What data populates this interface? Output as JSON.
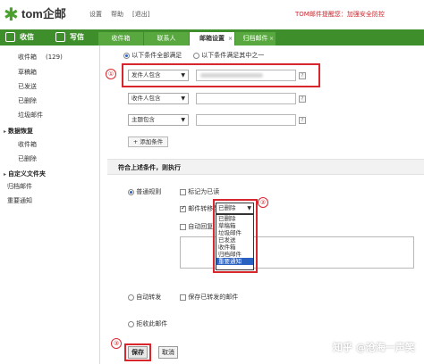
{
  "header": {
    "logo_symbol": "✱",
    "logo_text": "tom企邮",
    "links": [
      "设置",
      "帮助",
      "[退出]"
    ],
    "notice": "TOM邮件提醒您：加强安全防控"
  },
  "nav": {
    "inbox_label": "收信",
    "compose_label": "写信",
    "tabs": [
      {
        "label": "收件箱",
        "active": false
      },
      {
        "label": "联系人",
        "active": false
      },
      {
        "label": "邮箱设置",
        "active": true
      },
      {
        "label": "归档邮件",
        "active": false
      }
    ],
    "close_glyph": "×"
  },
  "sidebar": {
    "folders": [
      {
        "label": "收件箱",
        "count": "(129)"
      },
      {
        "label": "草稿箱",
        "count": ""
      },
      {
        "label": "已发送",
        "count": ""
      },
      {
        "label": "已删除",
        "count": ""
      },
      {
        "label": "垃圾邮件",
        "count": ""
      }
    ],
    "recovery_heading": "数据恢复",
    "recovery_items": [
      "收件箱",
      "已删除"
    ],
    "custom_heading": "自定义文件夹",
    "custom_items": [
      "归档邮件",
      "重要通知"
    ]
  },
  "conditions": {
    "match_all_label": "以下条件全部满足",
    "match_any_label": "以下条件满足其中之一",
    "rows": [
      {
        "field": "发件人包含",
        "value": ""
      },
      {
        "field": "收件人包含",
        "value": ""
      },
      {
        "field": "主题包含",
        "value": ""
      }
    ],
    "add_condition_label": "+ 添加条件",
    "help_glyph": "?"
  },
  "actions": {
    "section_title": "符合上述条件，则执行",
    "normal_rule_label": "普通规则",
    "mark_read_label": "标记为已读",
    "move_to_label": "邮件转移至",
    "auto_reply_label": "自动回复",
    "auto_forward_label": "自动转发",
    "keep_forwarded_label": "保存已转发的邮件",
    "reject_label": "拒收此邮件",
    "folder_selected": "已删除",
    "folder_options": [
      "已删除",
      "草稿箱",
      "垃圾邮件",
      "已发送",
      "收件箱",
      "归档邮件",
      "重要通知"
    ],
    "folder_highlighted": "重要通知"
  },
  "buttons": {
    "save_label": "保存",
    "cancel_label": "取消"
  },
  "callouts": [
    "①",
    "②",
    "③"
  ],
  "watermark": "知乎 @沧海一声笑",
  "colors": {
    "brand_green": "#3e8f2b",
    "notice_red": "#c8282f",
    "highlight_blue": "#2b62c2"
  }
}
